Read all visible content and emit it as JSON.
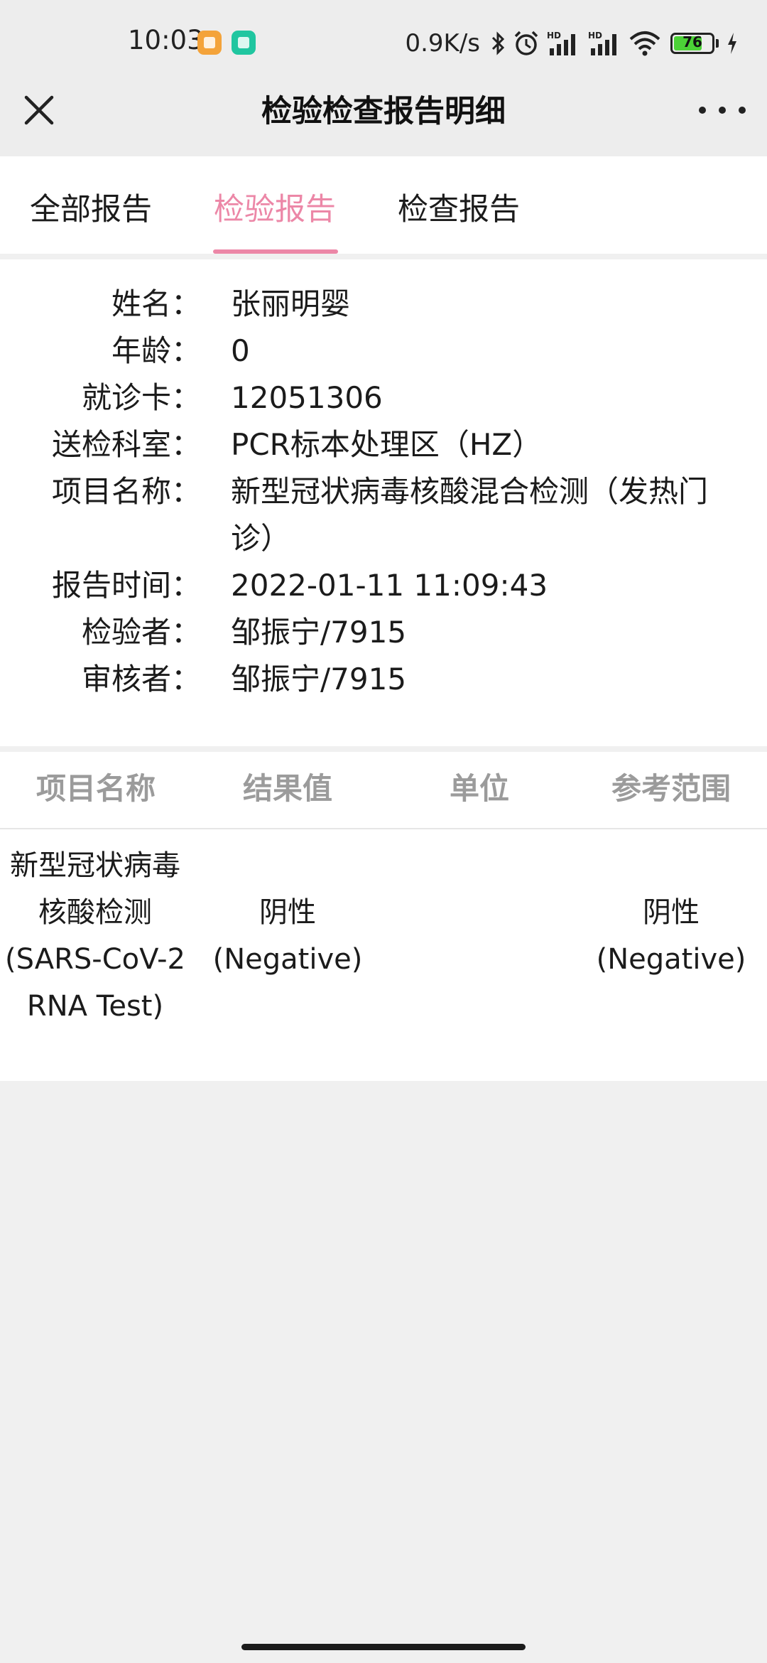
{
  "status_bar": {
    "time": "10:03",
    "net_speed": "0.9K/s",
    "battery": "76",
    "battery_level": 0.76,
    "icons": [
      "bluetooth-icon",
      "alarm-icon",
      "hd-signal-icon",
      "hd-signal-icon",
      "wifi-icon",
      "battery-icon",
      "charging-icon"
    ]
  },
  "header": {
    "title": "检验检查报告明细",
    "close_icon": "close-icon",
    "more_icon": "more-icon"
  },
  "tabs": [
    {
      "label": "全部报告",
      "active": false
    },
    {
      "label": "检验报告",
      "active": true
    },
    {
      "label": "检查报告",
      "active": false
    }
  ],
  "patient": [
    {
      "label": "姓名：",
      "value": "张丽明婴"
    },
    {
      "label": "年龄：",
      "value": "0"
    },
    {
      "label": "就诊卡：",
      "value": "12051306"
    },
    {
      "label": "送检科室：",
      "value": "PCR标本处理区（HZ）"
    },
    {
      "label": "项目名称：",
      "value": "新型冠状病毒核酸混合检测（发热门诊）"
    },
    {
      "label": "报告时间：",
      "value": "2022-01-11 11:09:43"
    },
    {
      "label": "检验者：",
      "value": "邹振宁/7915"
    },
    {
      "label": "审核者：",
      "value": "邹振宁/7915"
    }
  ],
  "results": {
    "headers": [
      "项目名称",
      "结果值",
      "单位",
      "参考范围"
    ],
    "rows": [
      {
        "name": "新型冠状病毒核酸检测(SARS-CoV-2 RNA Test)",
        "value": "阴性(Negative)",
        "unit": "",
        "ref": "阴性(Negative)"
      }
    ]
  },
  "colors": {
    "accent": "#ec87a7",
    "background": "#f0f0f0",
    "header_text": "#9b9b9b"
  }
}
